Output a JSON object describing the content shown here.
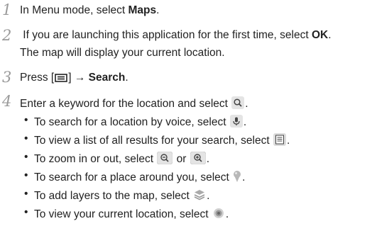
{
  "steps": [
    {
      "num": "1",
      "pre": "In Menu mode, select ",
      "bold": "Maps",
      "post": "."
    },
    {
      "num": "2",
      "pre": " If you are launching this application for the first time, select ",
      "bold": "OK",
      "post": ".",
      "cont": "The map will display your current location."
    },
    {
      "num": "3",
      "pre": "Press [",
      "mid": "] → ",
      "bold": "Search",
      "post": "."
    },
    {
      "num": "4",
      "pre": "Enter a keyword for the location and select ",
      "post": "."
    }
  ],
  "bullets": [
    {
      "pre": "To search for a location by voice, select ",
      "post": "."
    },
    {
      "pre": "To view a list of all results for your search, select ",
      "post": "."
    },
    {
      "pre": "To zoom in or out, select ",
      "mid": " or ",
      "post": "."
    },
    {
      "pre": "To search for a place around you, select ",
      "post": "."
    },
    {
      "pre": "To add layers to the map, select ",
      "post": "."
    },
    {
      "pre": "To view your current location, select ",
      "post": "."
    }
  ],
  "bullet_char": "•",
  "icons": {
    "menu_key": "menu-key-icon",
    "search": "search-icon",
    "voice": "microphone-icon",
    "list": "list-icon",
    "zoom_out": "zoom-out-icon",
    "zoom_in": "zoom-in-icon",
    "place": "location-pin-icon",
    "layers": "layers-icon",
    "my_location": "my-location-icon"
  },
  "colors": {
    "step_number": "#9a9a9a",
    "text": "#222222",
    "icon_bg": "#e4e4e4",
    "pin": "#b8b8b8"
  }
}
